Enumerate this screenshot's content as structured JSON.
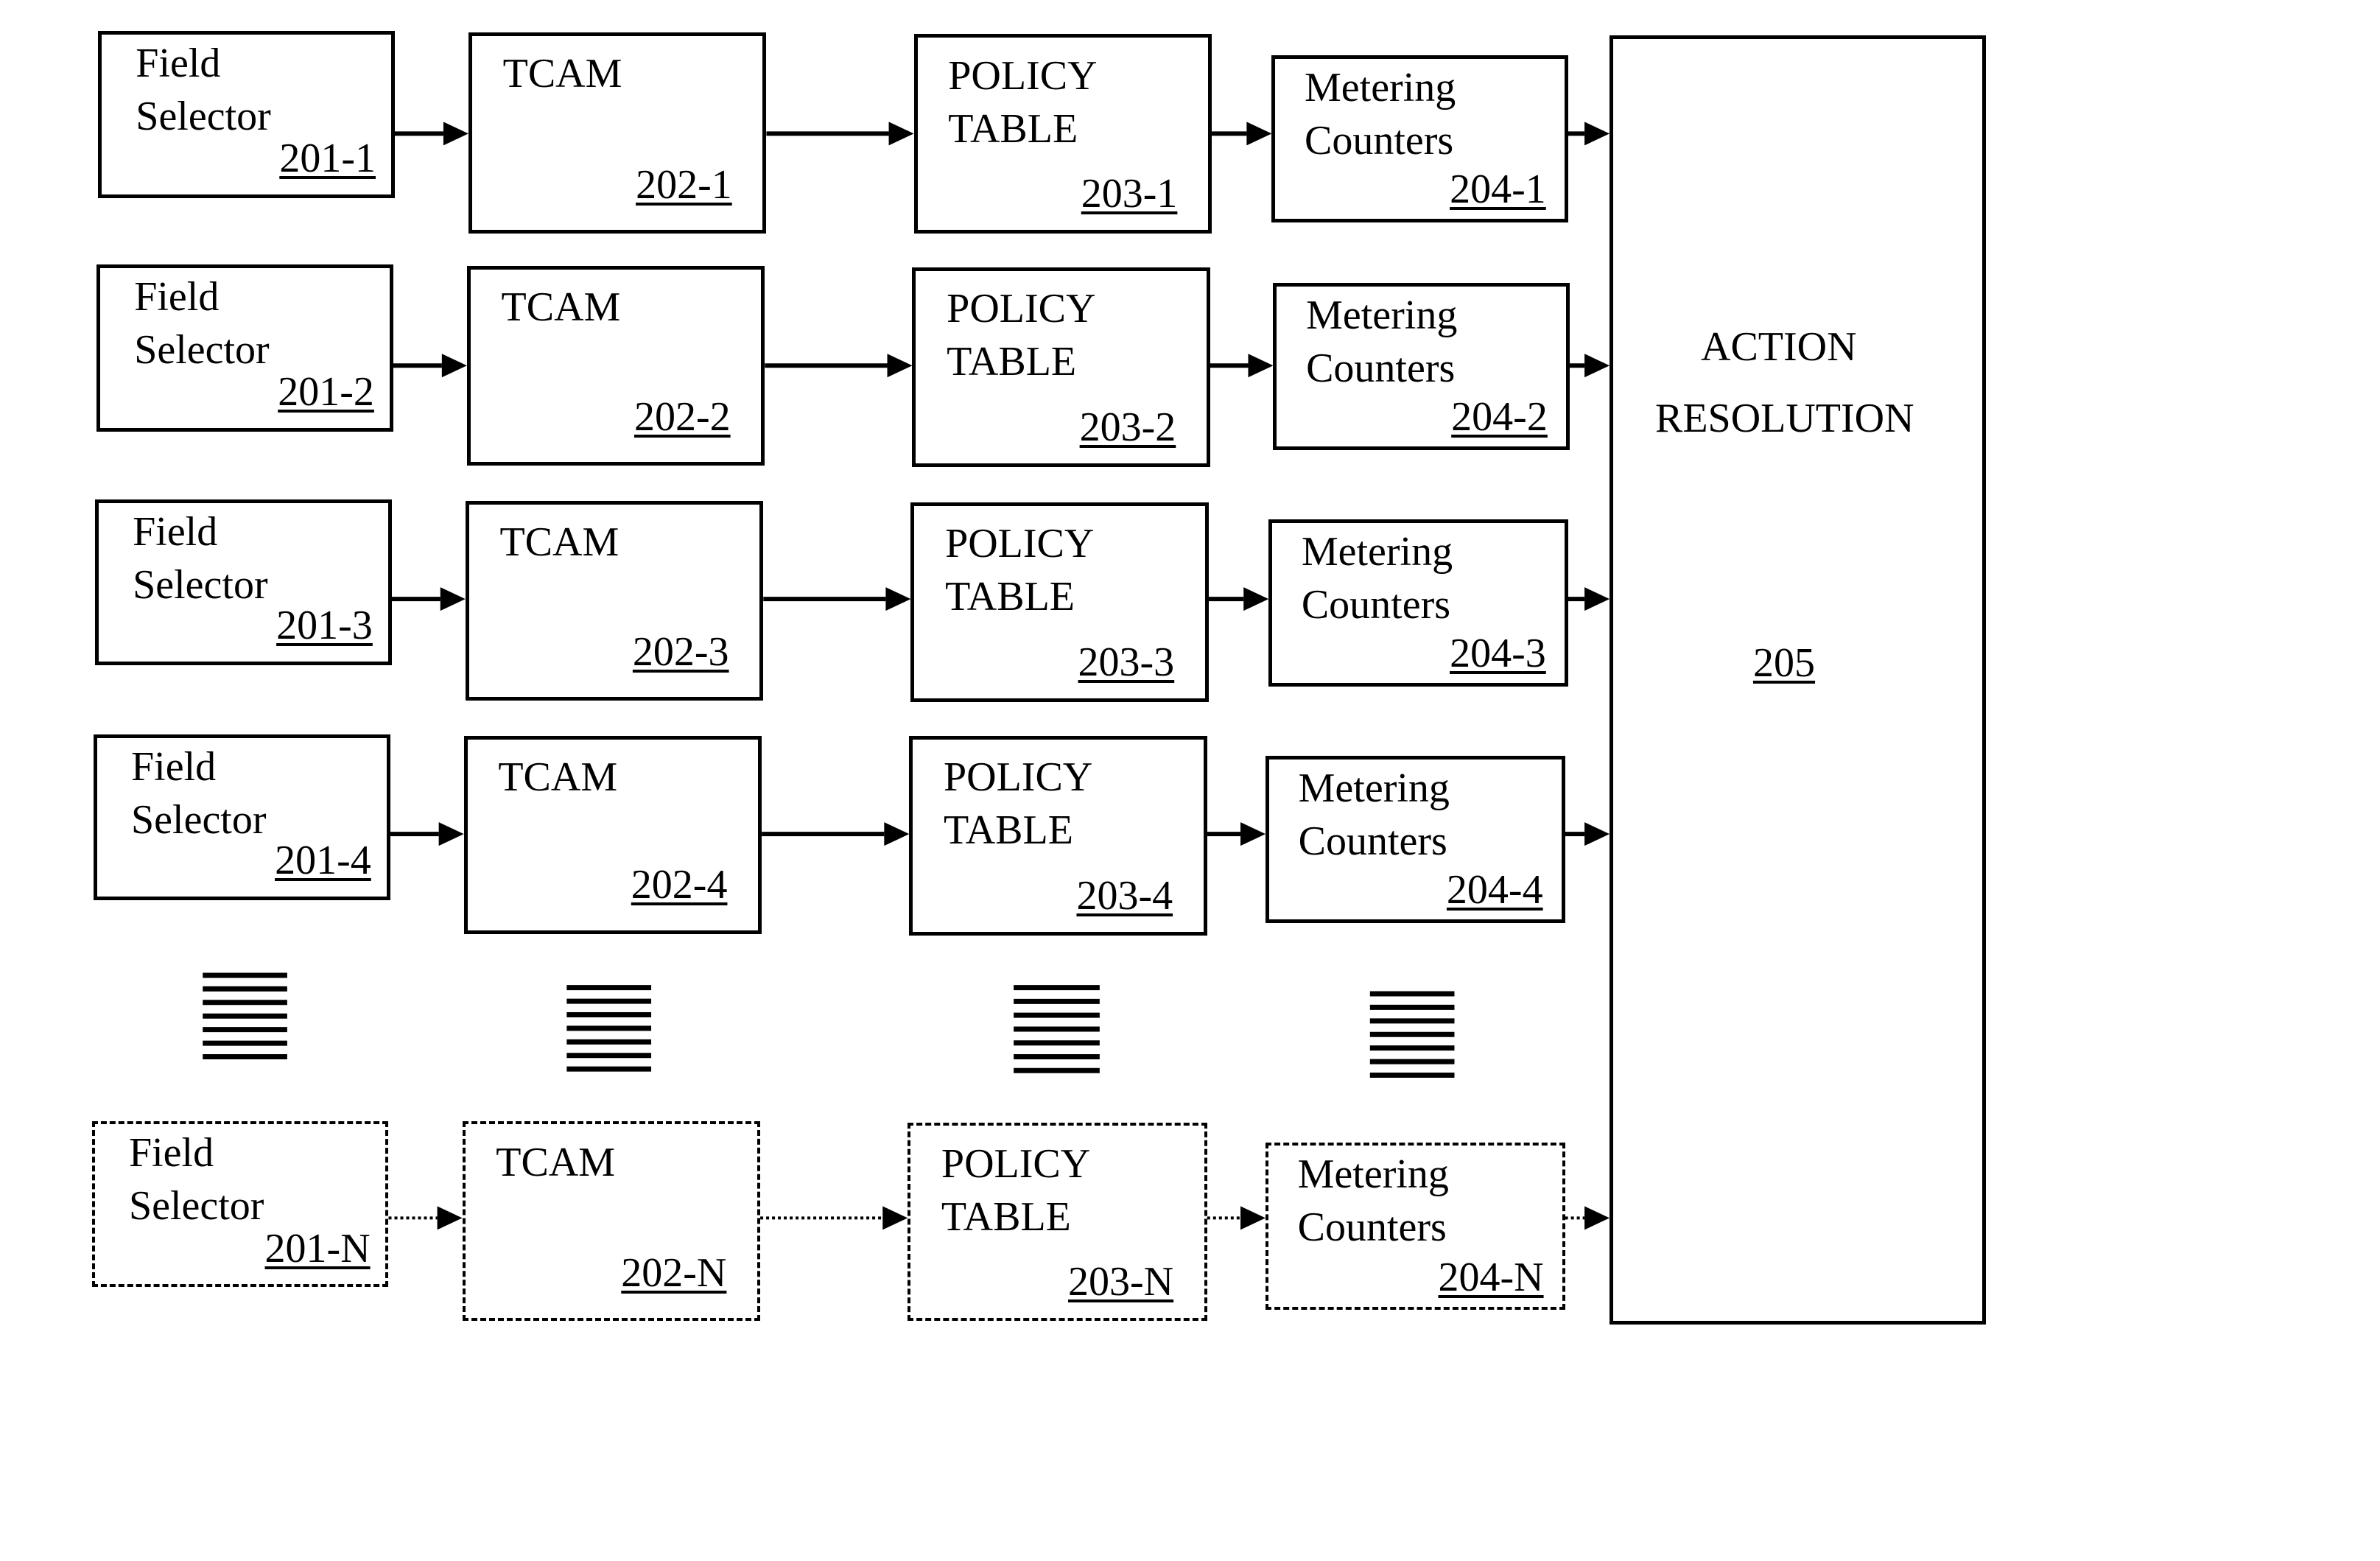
{
  "diagram": {
    "rows": [
      {
        "field_selector": {
          "lines": [
            "Field",
            "Selector"
          ],
          "ref": "201-1"
        },
        "tcam": {
          "lines": [
            "TCAM"
          ],
          "ref": "202-1"
        },
        "policy_table": {
          "lines": [
            "POLICY",
            "TABLE"
          ],
          "ref": "203-1"
        },
        "metering_counters": {
          "lines": [
            "Metering",
            "Counters"
          ],
          "ref": "204-1"
        },
        "style": "solid"
      },
      {
        "field_selector": {
          "lines": [
            "Field",
            "Selector"
          ],
          "ref": "201-2"
        },
        "tcam": {
          "lines": [
            "TCAM"
          ],
          "ref": "202-2"
        },
        "policy_table": {
          "lines": [
            "POLICY",
            "TABLE"
          ],
          "ref": "203-2"
        },
        "metering_counters": {
          "lines": [
            "Metering",
            "Counters"
          ],
          "ref": "204-2"
        },
        "style": "solid"
      },
      {
        "field_selector": {
          "lines": [
            "Field",
            "Selector"
          ],
          "ref": "201-3"
        },
        "tcam": {
          "lines": [
            "TCAM"
          ],
          "ref": "202-3"
        },
        "policy_table": {
          "lines": [
            "POLICY",
            "TABLE"
          ],
          "ref": "203-3"
        },
        "metering_counters": {
          "lines": [
            "Metering",
            "Counters"
          ],
          "ref": "204-3"
        },
        "style": "solid"
      },
      {
        "field_selector": {
          "lines": [
            "Field",
            "Selector"
          ],
          "ref": "201-4"
        },
        "tcam": {
          "lines": [
            "TCAM"
          ],
          "ref": "202-4"
        },
        "policy_table": {
          "lines": [
            "POLICY",
            "TABLE"
          ],
          "ref": "203-4"
        },
        "metering_counters": {
          "lines": [
            "Metering",
            "Counters"
          ],
          "ref": "204-4"
        },
        "style": "solid"
      },
      {
        "field_selector": {
          "lines": [
            "Field",
            "Selector"
          ],
          "ref": "201-N"
        },
        "tcam": {
          "lines": [
            "TCAM"
          ],
          "ref": "202-N"
        },
        "policy_table": {
          "lines": [
            "POLICY",
            "TABLE"
          ],
          "ref": "203-N"
        },
        "metering_counters": {
          "lines": [
            "Metering",
            "Counters"
          ],
          "ref": "204-N"
        },
        "style": "dashed"
      }
    ],
    "action_resolution": {
      "lines": [
        "ACTION",
        "RESOLUTION"
      ],
      "ref": "205"
    },
    "ellipsis": {
      "columns": 4,
      "lines_per_column": 7
    },
    "edges": [
      {
        "from": "field_selector",
        "to": "tcam"
      },
      {
        "from": "tcam",
        "to": "policy_table"
      },
      {
        "from": "policy_table",
        "to": "metering_counters"
      },
      {
        "from": "metering_counters",
        "to": "action_resolution"
      }
    ]
  }
}
